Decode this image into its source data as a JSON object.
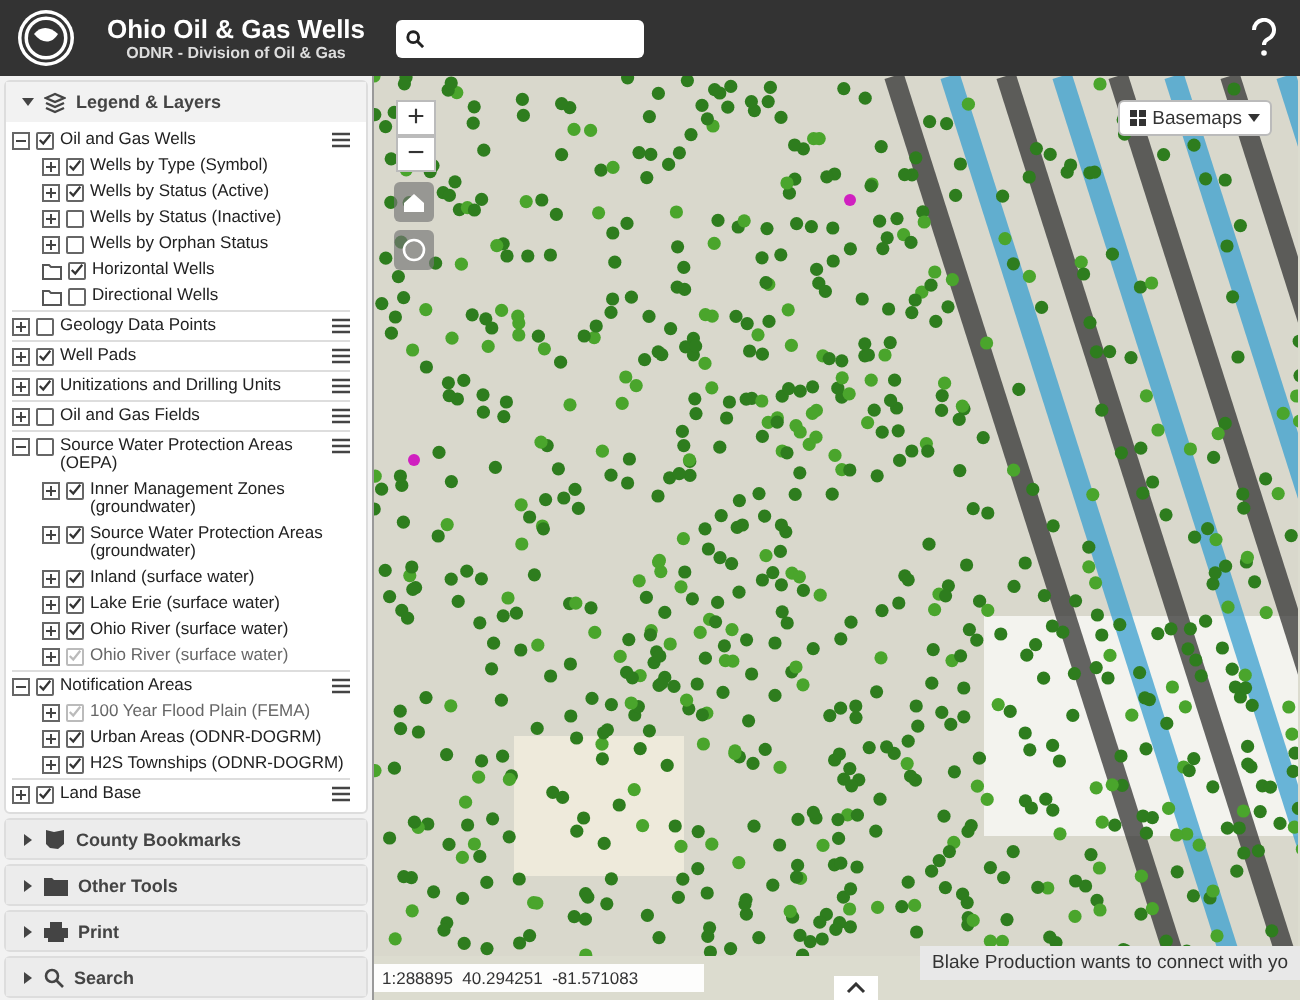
{
  "header": {
    "title": "Ohio Oil & Gas Wells",
    "subtitle": "ODNR - Division of Oil & Gas"
  },
  "panels": [
    {
      "title": "Legend & Layers",
      "expanded": true
    },
    {
      "title": "County Bookmarks",
      "expanded": false
    },
    {
      "title": "Other Tools",
      "expanded": false
    },
    {
      "title": "Print",
      "expanded": false
    },
    {
      "title": "Search",
      "expanded": false
    }
  ],
  "layers": [
    {
      "label": "Oil and Gas Wells",
      "checked": true,
      "expanded": true,
      "children": [
        {
          "label": "Wells by Type (Symbol)",
          "checked": true,
          "disabled": false,
          "kind": "expandable"
        },
        {
          "label": "Wells by Status (Active)",
          "checked": true,
          "disabled": false,
          "kind": "expandable"
        },
        {
          "label": "Wells by Status (Inactive)",
          "checked": false,
          "disabled": false,
          "kind": "expandable"
        },
        {
          "label": "Wells by Orphan Status",
          "checked": false,
          "disabled": false,
          "kind": "expandable"
        },
        {
          "label": "Horizontal Wells",
          "checked": true,
          "disabled": false,
          "kind": "folder"
        },
        {
          "label": "Directional Wells",
          "checked": false,
          "disabled": false,
          "kind": "folder"
        }
      ]
    },
    {
      "label": "Geology Data Points",
      "checked": false,
      "expanded": false
    },
    {
      "label": "Well Pads",
      "checked": true,
      "expanded": false
    },
    {
      "label": "Unitizations and Drilling Units",
      "checked": true,
      "expanded": false
    },
    {
      "label": "Oil and Gas Fields",
      "checked": false,
      "expanded": false
    },
    {
      "label": "Source Water Protection Areas (OEPA)",
      "checked": false,
      "expanded": true,
      "children": [
        {
          "label": "Inner Management Zones (groundwater)",
          "checked": true,
          "disabled": false,
          "kind": "expandable"
        },
        {
          "label": "Source Water Protection Areas (groundwater)",
          "checked": true,
          "disabled": false,
          "kind": "expandable"
        },
        {
          "label": "Inland (surface water)",
          "checked": true,
          "disabled": false,
          "kind": "expandable"
        },
        {
          "label": "Lake Erie (surface water)",
          "checked": true,
          "disabled": false,
          "kind": "expandable"
        },
        {
          "label": "Ohio River (surface water)",
          "checked": true,
          "disabled": false,
          "kind": "expandable"
        },
        {
          "label": "Ohio River (surface water)",
          "checked": true,
          "disabled": true,
          "kind": "expandable"
        }
      ]
    },
    {
      "label": "Notification Areas",
      "checked": true,
      "expanded": true,
      "children": [
        {
          "label": "100 Year Flood Plain (FEMA)",
          "checked": true,
          "disabled": true,
          "kind": "expandable"
        },
        {
          "label": "Urban Areas (ODNR-DOGRM)",
          "checked": true,
          "disabled": false,
          "kind": "expandable"
        },
        {
          "label": "H2S Townships (ODNR-DOGRM)",
          "checked": true,
          "disabled": false,
          "kind": "expandable"
        }
      ]
    },
    {
      "label": "Land Base",
      "checked": true,
      "expanded": false
    }
  ],
  "map": {
    "zoom_in": "+",
    "zoom_out": "−",
    "basemaps": "Basemaps",
    "scale": "1:288895  40.294251  -81.571083",
    "notification": "Blake Production wants to connect with yo"
  }
}
